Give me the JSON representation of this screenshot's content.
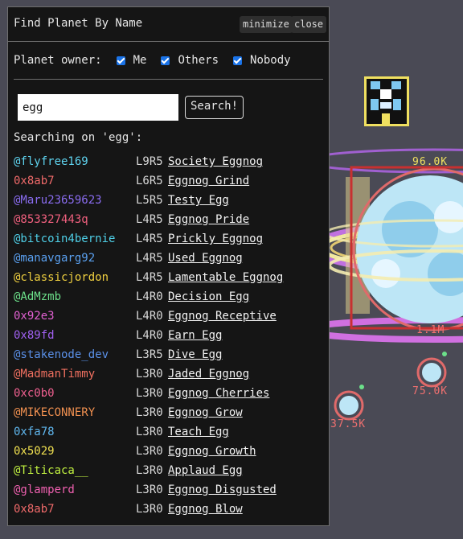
{
  "panel": {
    "title": "Find Planet By Name",
    "minimize_label": "minimize",
    "close_label": "close",
    "owner_filter": {
      "label": "Planet owner:",
      "options": [
        {
          "label": "Me",
          "checked": true
        },
        {
          "label": "Others",
          "checked": true
        },
        {
          "label": "Nobody",
          "checked": true
        }
      ]
    },
    "search": {
      "value": "egg",
      "button_label": "Search!",
      "status": "Searching on 'egg':"
    },
    "results": [
      {
        "owner": "@flyfree169",
        "owner_color": "#5fd4f0",
        "level": "L9R5",
        "planet": "Society Eggnog"
      },
      {
        "owner": "0x8ab7",
        "owner_color": "#f06a6a",
        "level": "L6R5",
        "planet": "Eggnog Grind"
      },
      {
        "owner": "@Maru23659623",
        "owner_color": "#8a6cf0",
        "level": "L5R5",
        "planet": "Testy Egg"
      },
      {
        "owner": "@853327443q",
        "owner_color": "#f0607e",
        "level": "L4R5",
        "planet": "Eggnog Pride"
      },
      {
        "owner": "@bitcoin4bernie",
        "owner_color": "#4fd0e8",
        "level": "L4R5",
        "planet": "Prickly Eggnog"
      },
      {
        "owner": "@manavgarg92",
        "owner_color": "#5aa0f0",
        "level": "L4R5",
        "planet": "Used Eggnog"
      },
      {
        "owner": "@classicjordon",
        "owner_color": "#f0d040",
        "level": "L4R5",
        "planet": "Lamentable Eggnog"
      },
      {
        "owner": "@AdMzmb",
        "owner_color": "#6ce08a",
        "level": "L4R0",
        "planet": "Decision Egg"
      },
      {
        "owner": "0x92e3",
        "owner_color": "#e060d0",
        "level": "L4R0",
        "planet": "Eggnog Receptive"
      },
      {
        "owner": "0x89fd",
        "owner_color": "#a060f0",
        "level": "L4R0",
        "planet": "Earn Egg"
      },
      {
        "owner": "@stakenode_dev",
        "owner_color": "#5a90e8",
        "level": "L3R5",
        "planet": "Dive Egg"
      },
      {
        "owner": "@MadmanTimmy",
        "owner_color": "#f07060",
        "level": "L3R0",
        "planet": "Jaded Eggnog"
      },
      {
        "owner": "0xc0b0",
        "owner_color": "#f06090",
        "level": "L3R0",
        "planet": "Eggnog Cherries"
      },
      {
        "owner": "@MIKECONNERY",
        "owner_color": "#f09050",
        "level": "L3R0",
        "planet": "Eggnog Grow"
      },
      {
        "owner": "0xfa78",
        "owner_color": "#60b8f0",
        "level": "L3R0",
        "planet": "Teach Egg"
      },
      {
        "owner": "0x5029",
        "owner_color": "#f0e050",
        "level": "L3R0",
        "planet": "Eggnog Growth"
      },
      {
        "owner": "@Titicaca__",
        "owner_color": "#c0f040",
        "level": "L3R0",
        "planet": "Applaud Egg"
      },
      {
        "owner": "@glamperd",
        "owner_color": "#f060b0",
        "level": "L3R0",
        "planet": "Eggnog Disgusted"
      },
      {
        "owner": "0x8ab7",
        "owner_color": "#f06a6a",
        "level": "L3R0",
        "planet": "Eggnog Blow"
      }
    ]
  },
  "map": {
    "planet_labels": [
      {
        "text": "96.0K",
        "color": "#f0e060"
      },
      {
        "text": "1.1M",
        "color": "#f07070"
      },
      {
        "text": "75.0K",
        "color": "#f07070"
      },
      {
        "text": "37.5K",
        "color": "#f07070"
      }
    ]
  }
}
